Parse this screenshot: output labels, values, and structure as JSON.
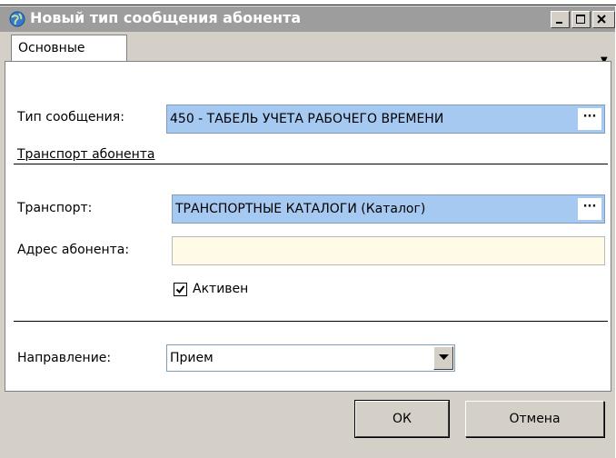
{
  "window": {
    "title": "Новый тип сообщения абонента"
  },
  "tabs": [
    {
      "label": "Основные",
      "active": true
    }
  ],
  "form": {
    "message_type_label": "Тип сообщения:",
    "message_type_value": "450 - ТАБЕЛЬ УЧЕТА РАБОЧЕГО ВРЕМЕНИ",
    "transport_section_title": "Транспорт абонента",
    "transport_label": "Транспорт:",
    "transport_value": "ТРАНСПОРТНЫЕ КАТАЛОГИ (Каталог)",
    "address_label": "Адрес абонента:",
    "address_value": "",
    "active_label": "Активен",
    "active_checked": true,
    "direction_label": "Направление:",
    "direction_value": "Прием",
    "ellipsis": "···"
  },
  "buttons": {
    "ok": "ОК",
    "cancel": "Отмена"
  }
}
